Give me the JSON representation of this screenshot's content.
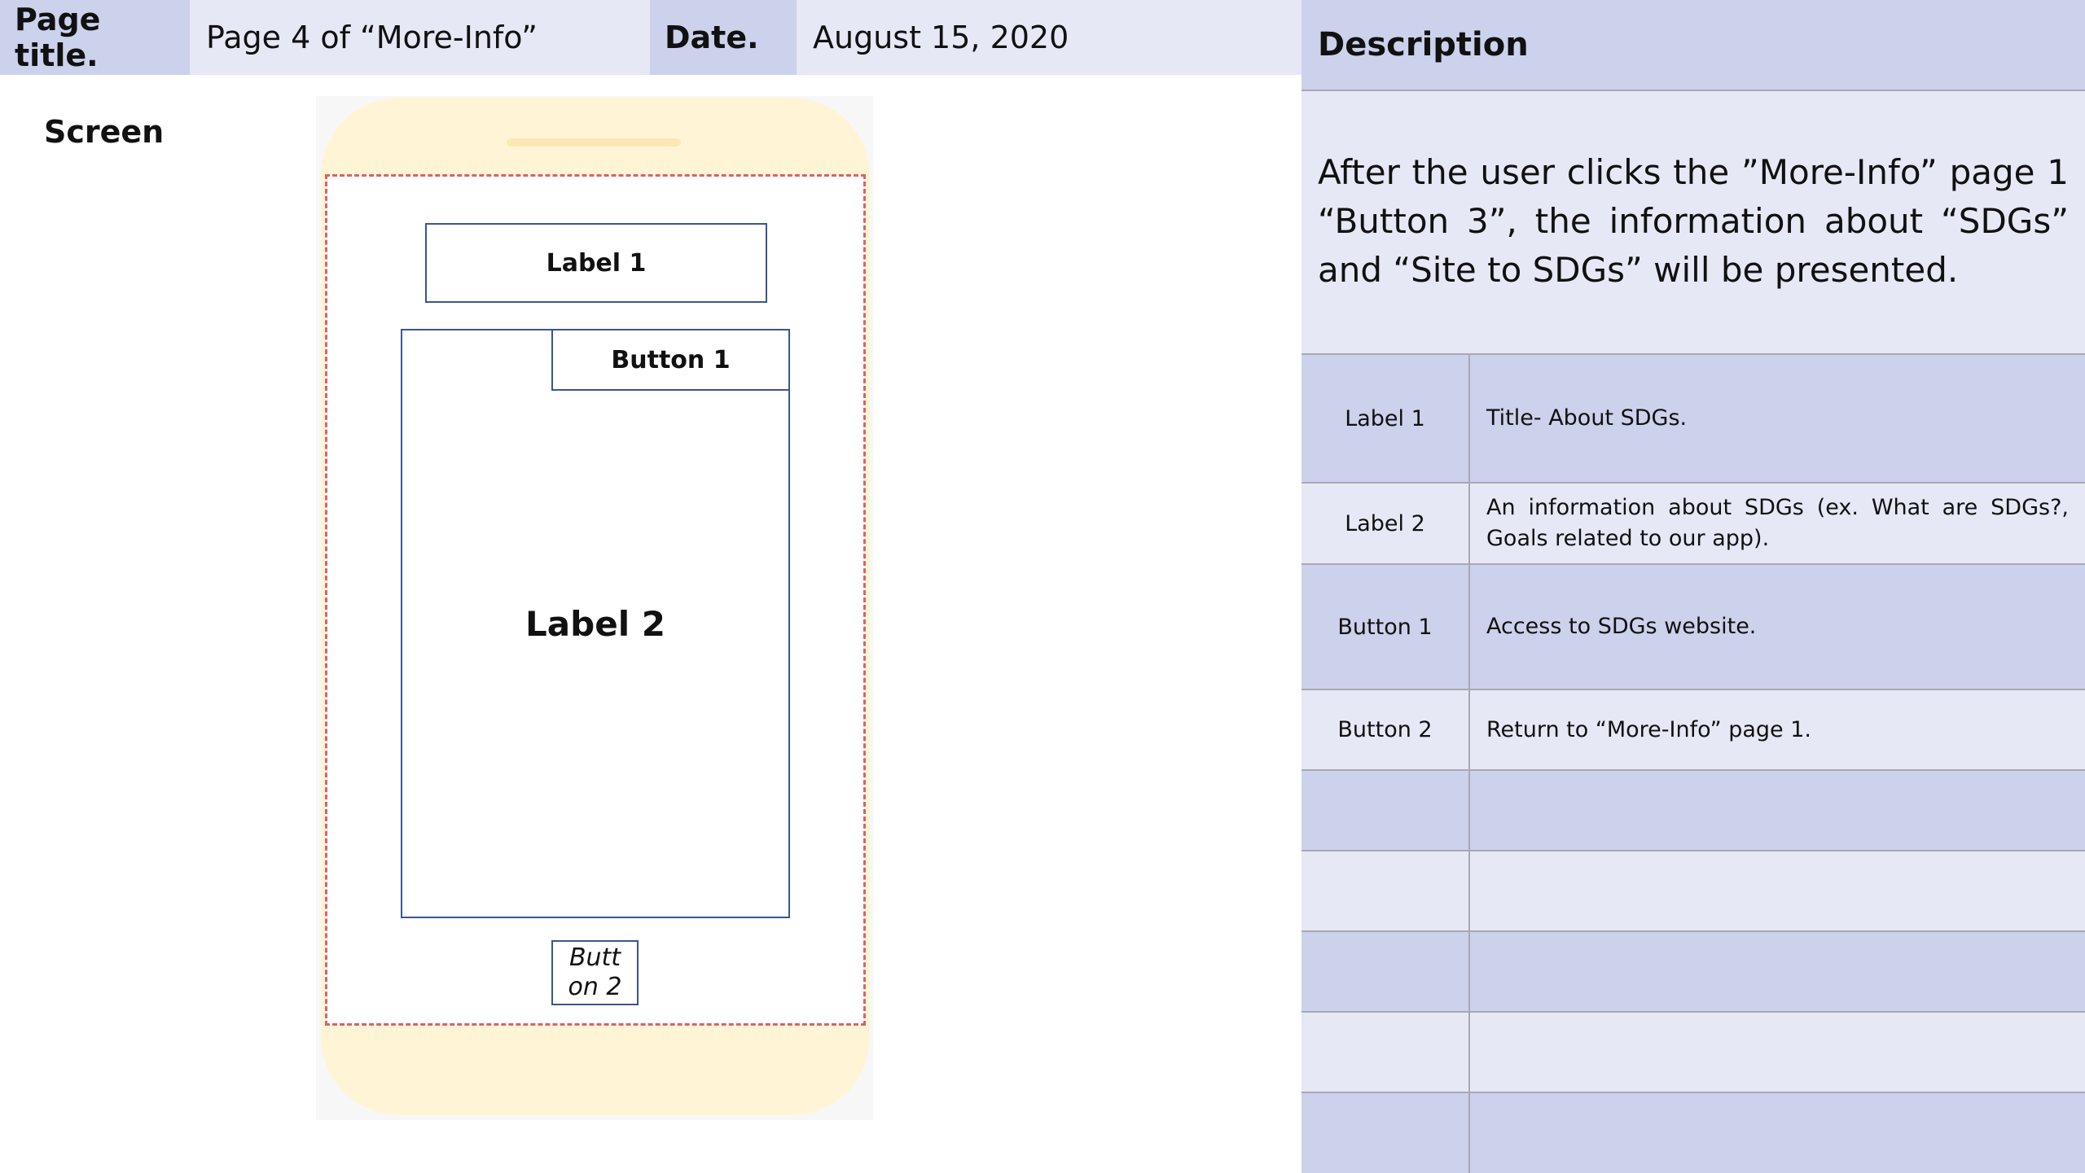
{
  "header": {
    "page_title_label": "Page title.",
    "page_title_value": "Page 4 of “More-Info”",
    "date_label": "Date.",
    "date_value": "August 15, 2020"
  },
  "screen": {
    "label": "Screen",
    "widgets": {
      "label1": "Label 1",
      "label2": "Label 2",
      "button1": "Button 1",
      "button2_line1": "Butt",
      "button2_line2": "on 2"
    }
  },
  "description": {
    "header": "Description",
    "text": "After the user clicks the ”More-Info” page 1 “Button 3”, the information about “SDGs” and “Site to SDGs” will be presented.",
    "rows": [
      {
        "key": "Label 1",
        "value": "Title- About SDGs."
      },
      {
        "key": "Label 2",
        "value": "An information about SDGs (ex. What are SDGs?, Goals related to our app)."
      },
      {
        "key": "Button 1",
        "value": "Access to SDGs website."
      },
      {
        "key": "Button 2",
        "value": "Return to “More-Info” page 1."
      },
      {
        "key": "",
        "value": ""
      },
      {
        "key": "",
        "value": ""
      },
      {
        "key": "",
        "value": ""
      },
      {
        "key": "",
        "value": ""
      },
      {
        "key": "",
        "value": ""
      }
    ]
  }
}
